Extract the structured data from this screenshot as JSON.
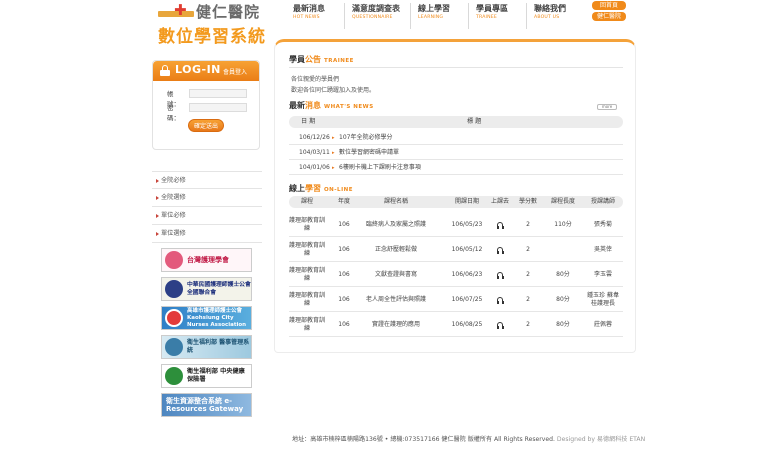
{
  "logo": {
    "hospital": "健仁醫院",
    "system": "數位學習系統"
  },
  "nav": [
    {
      "zh": "最新消息",
      "en": "HOT NEWS"
    },
    {
      "zh": "滿意度調查表",
      "en": "QUESTIONNAIRE"
    },
    {
      "zh": "線上學習",
      "en": "LEARNING"
    },
    {
      "zh": "學員專區",
      "en": "TRAINEE"
    },
    {
      "zh": "聯絡我們",
      "en": "ABOUT US"
    }
  ],
  "top_buttons": {
    "home": "回首頁",
    "hospital": "健仁醫院"
  },
  "login": {
    "title": "LOG-IN",
    "subtitle": "會員登入",
    "account_label": "帳　號：",
    "password_label": "密　碼：",
    "submit": "確定送出"
  },
  "side_menu": [
    "全院必修",
    "全院選修",
    "單位必修",
    "單位選修"
  ],
  "banners": [
    "台灣護理學會",
    "中華民國護理師護士公會全國聯合會",
    "高雄市護理師護士公會 Kaohsiung City Nurses Association",
    "衛生福利部 醫事管理系統",
    "衛生福利部 中央健康保險署",
    "衛生資源整合系統 e-Resources Gateway"
  ],
  "trainee": {
    "title_zh_1": "學員",
    "title_zh_2": "公告",
    "title_en": "TRAINEE",
    "line1": "各位親愛的學員們",
    "line2": "歡迎各位同仁踴躍加入及使用。"
  },
  "news": {
    "title_zh_1": "最新",
    "title_zh_2": "消息",
    "title_en": "WHAT'S NEWS",
    "more": "more",
    "col_date": "日 期",
    "col_title": "標 題",
    "rows": [
      {
        "date": "106/12/26",
        "title": "107年全院必修學分"
      },
      {
        "date": "104/03/11",
        "title": "數位學習網密碼申請單"
      },
      {
        "date": "104/01/06",
        "title": "6樓刷卡機上下課刷卡注意事項"
      }
    ]
  },
  "online": {
    "title_zh_1": "線上",
    "title_zh_2": "學習",
    "title_en": "ON-LINE",
    "columns": [
      "課程",
      "年度",
      "課程名稱",
      "開課日期",
      "上課去",
      "學分數",
      "課程長度",
      "授課講師"
    ],
    "rows": [
      {
        "category": "護理部教育訓練",
        "year": "106",
        "name": "臨終病人及家屬之照護",
        "date": "106/05/23",
        "credits": "2",
        "duration": "110分",
        "teacher": "張秀菊"
      },
      {
        "category": "護理部教育訓練",
        "year": "106",
        "name": "正念舒壓輕鬆做",
        "date": "106/05/12",
        "credits": "2",
        "duration": "",
        "teacher": "吳英倖"
      },
      {
        "category": "護理部教育訓練",
        "year": "106",
        "name": "文獻查證與書寫",
        "date": "106/06/23",
        "credits": "2",
        "duration": "80分",
        "teacher": "李玉雲"
      },
      {
        "category": "護理部教育訓練",
        "year": "106",
        "name": "老人周全性評估與照護",
        "date": "106/07/25",
        "credits": "2",
        "duration": "80分",
        "teacher": "鍾玉珍 蘇韋桂護理長"
      },
      {
        "category": "護理部教育訓練",
        "year": "106",
        "name": "實證在護理的應用",
        "date": "106/08/25",
        "credits": "2",
        "duration": "80分",
        "teacher": "莊佩蓉"
      }
    ]
  },
  "footer": {
    "address": "地址：高雄市楠梓區楠陽路136號 • 總機:073517166 健仁醫院 版權所有 All Rights Reserved.",
    "designer": "Designed by 易德網科技 ETAN"
  },
  "colors": {
    "accent": "#f08a1a",
    "brand_red": "#e03c31"
  }
}
